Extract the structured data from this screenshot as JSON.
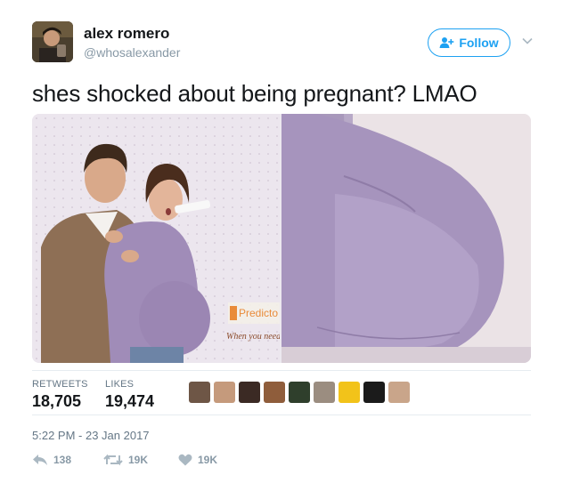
{
  "tweet": {
    "author_name": "alex romero",
    "author_handle": "@whosalexander",
    "follow_label": "Follow",
    "text": "shes shocked about being pregnant? LMAO",
    "stats": {
      "retweets_label": "RETWEETS",
      "retweets_value": "18,705",
      "likes_label": "LIKES",
      "likes_value": "19,474"
    },
    "timestamp": "5:22 PM - 23 Jan 2017",
    "actions": {
      "reply_count": "138",
      "retweet_count": "19K",
      "like_count": "19K"
    },
    "media_overlay": {
      "brand": "Predicto",
      "tagline": "When you need"
    }
  },
  "icons": {
    "follow": "add-user-icon",
    "caret": "chevron-down-icon",
    "reply": "reply-icon",
    "retweet": "retweet-icon",
    "like": "heart-icon"
  },
  "colors": {
    "accent": "#1da1f2",
    "muted": "#8899a6",
    "text": "#14171a"
  }
}
